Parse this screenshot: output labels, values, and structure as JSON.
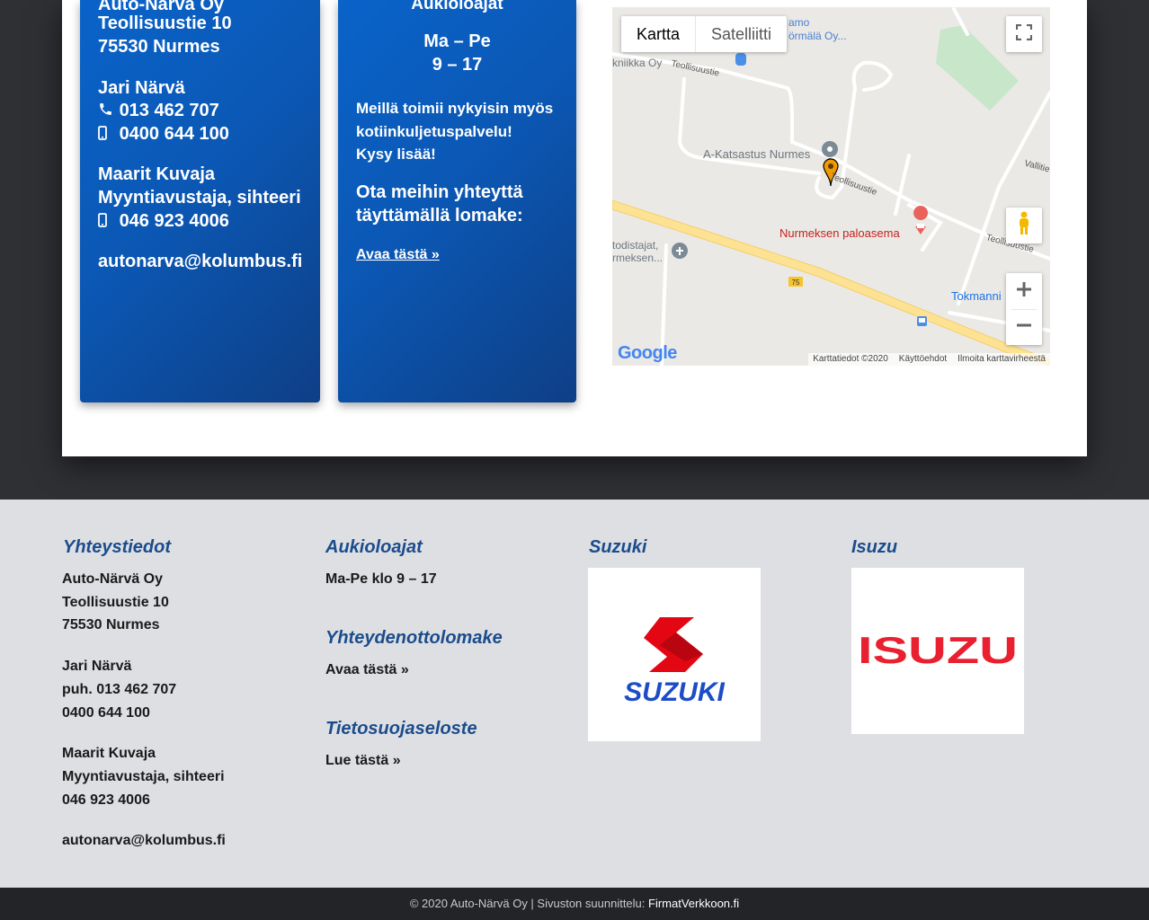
{
  "contact_card": {
    "company": "Auto-Närvä Oy",
    "street": "Teollisuustie 10",
    "postal": "75530 Nurmes",
    "person1_name": "Jari Närvä",
    "person1_phone": "013 462 707",
    "person1_mobile": "0400 644 100",
    "person2_name": "Maarit Kuvaja",
    "person2_title": "Myyntiavustaja, sihteeri",
    "person2_mobile": "046 923 4006",
    "email": "autonarva@kolumbus.fi"
  },
  "hours_card": {
    "title": "Aukioloajat",
    "days": "Ma – Pe",
    "hours": "9 – 17",
    "delivery_line1": "Meillä toimii nykyisin myös",
    "delivery_line2": "kotiinkuljetuspalvelu!",
    "delivery_line3": "Kysy lisää!",
    "contact_line1": "Ota meihin yhteyttä",
    "contact_line2": "täyttämällä lomake:",
    "form_link": "Avaa tästä »"
  },
  "map": {
    "tab_map": "Kartta",
    "tab_satellite": "Satelliitti",
    "labels": {
      "katsastus": "A-Katsastus Nurmes",
      "paloasema": "Nurmeksen paloasema",
      "tokmanni": "Tokmanni",
      "teollisuustie1": "Teollisuustie",
      "teollisuustie2": "Teollisuustie",
      "teollisuustie3": "Teollisuustie",
      "vallitie": "Vallitie",
      "road75": "75",
      "amo": "amo",
      "ormala": "örmälä Oy...",
      "tekniikka": "kniikka Oy",
      "todistajat1": "todistajat,",
      "todistajat2": "rmeksen..."
    },
    "google_logo": "Google",
    "attr_data": "Karttatiedot ©2020",
    "attr_terms": "Käyttöehdot",
    "attr_report": "Ilmoita karttavirheestä",
    "colors": {
      "pin": "#f29900",
      "road_major": "#fde293",
      "park": "#c8e6c9"
    }
  },
  "footer": {
    "contact": {
      "heading": "Yhteystiedot",
      "company": "Auto-Närvä Oy",
      "street": "Teollisuustie 10",
      "postal": "75530 Nurmes",
      "person1_name": "Jari Närvä",
      "person1_phone": "puh. 013 462 707",
      "person1_mobile": "0400 644 100",
      "person2_name": "Maarit Kuvaja",
      "person2_title": "Myyntiavustaja, sihteeri",
      "person2_mobile": "046 923 4006",
      "email": "autonarva@kolumbus.fi"
    },
    "hours": {
      "heading": "Aukioloajat",
      "text": "Ma-Pe klo 9 – 17"
    },
    "form": {
      "heading": "Yhteydenottolomake",
      "link": "Avaa tästä »"
    },
    "privacy": {
      "heading": "Tietosuojaseloste",
      "link": "Lue tästä »"
    },
    "suzuki": {
      "heading": "Suzuki",
      "logo_text": "SUZUKI"
    },
    "isuzu": {
      "heading": "Isuzu",
      "logo_text": "ISUZU"
    }
  },
  "copyright": {
    "text": "© 2020 Auto-Närvä Oy | Sivuston suunnittelu: ",
    "brand": "FirmatVerkkoon.fi"
  },
  "colors": {
    "card_blue": "#0b5dbf",
    "footer_heading": "#1b4c8c",
    "suzuki_red": "#e30613",
    "suzuki_blue": "#1c4cc6",
    "isuzu_red": "#e8202f"
  }
}
